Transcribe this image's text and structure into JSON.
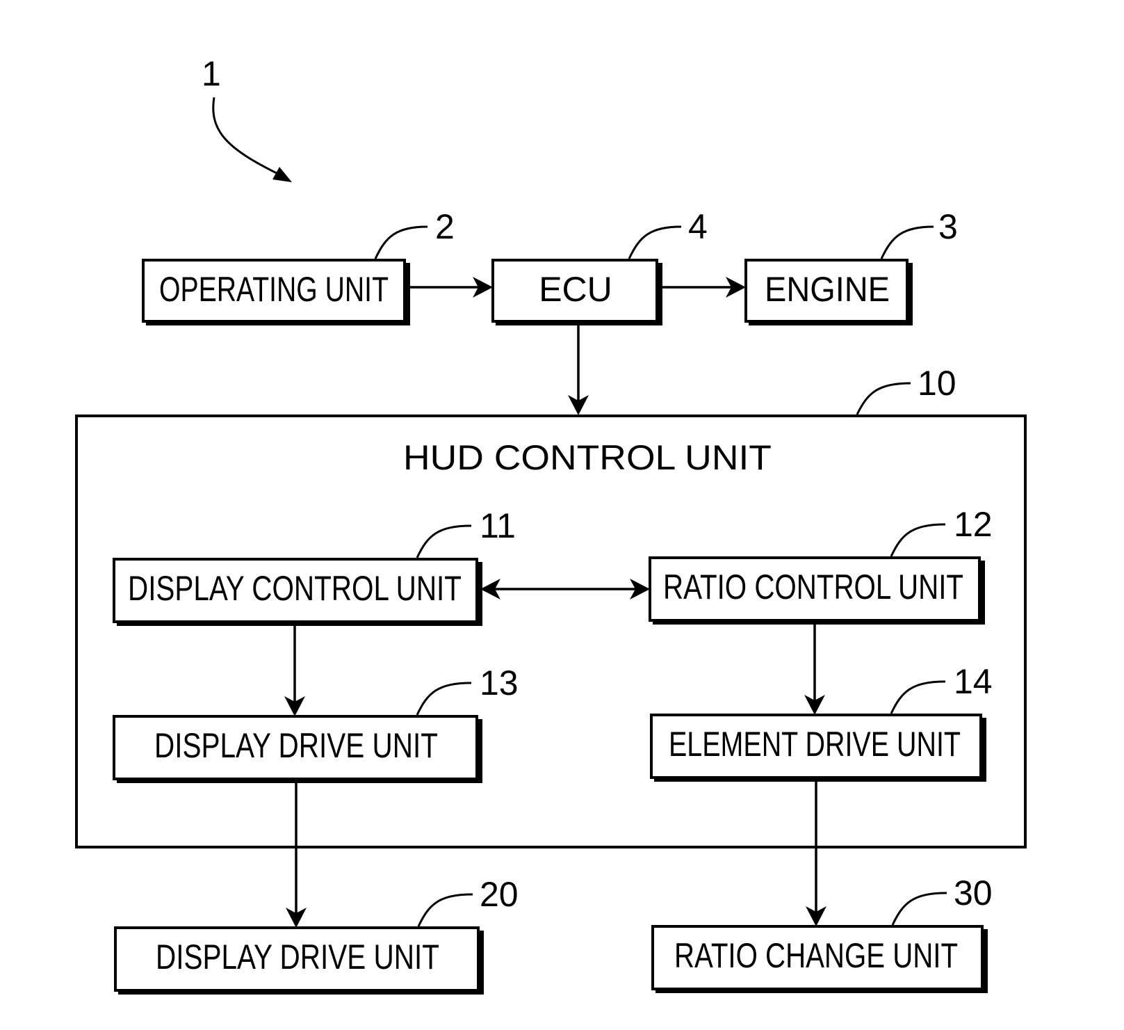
{
  "figure": {
    "reference": "1"
  },
  "blocks": {
    "operating_unit": {
      "label": "OPERATING UNIT",
      "ref": "2"
    },
    "ecu": {
      "label": "ECU",
      "ref": "4"
    },
    "engine": {
      "label": "ENGINE",
      "ref": "3"
    },
    "hud_control_unit": {
      "label": "HUD CONTROL UNIT",
      "ref": "10"
    },
    "display_control_unit": {
      "label": "DISPLAY CONTROL UNIT",
      "ref": "11"
    },
    "ratio_control_unit": {
      "label": "RATIO CONTROL UNIT",
      "ref": "12"
    },
    "display_drive_unit_inner": {
      "label": "DISPLAY DRIVE UNIT",
      "ref": "13"
    },
    "element_drive_unit": {
      "label": "ELEMENT DRIVE UNIT",
      "ref": "14"
    },
    "display_drive_unit_outer": {
      "label": "DISPLAY DRIVE UNIT",
      "ref": "20"
    },
    "ratio_change_unit": {
      "label": "RATIO CHANGE UNIT",
      "ref": "30"
    }
  },
  "connections": [
    {
      "from": "OPERATING UNIT",
      "to": "ECU",
      "direction": "one-way"
    },
    {
      "from": "ECU",
      "to": "ENGINE",
      "direction": "one-way"
    },
    {
      "from": "ECU",
      "to": "HUD CONTROL UNIT",
      "direction": "one-way"
    },
    {
      "from": "DISPLAY CONTROL UNIT",
      "to": "RATIO CONTROL UNIT",
      "direction": "two-way"
    },
    {
      "from": "DISPLAY CONTROL UNIT",
      "to": "DISPLAY DRIVE UNIT (13)",
      "direction": "one-way"
    },
    {
      "from": "RATIO CONTROL UNIT",
      "to": "ELEMENT DRIVE UNIT",
      "direction": "one-way"
    },
    {
      "from": "DISPLAY DRIVE UNIT (13)",
      "to": "DISPLAY DRIVE UNIT (20)",
      "direction": "one-way"
    },
    {
      "from": "ELEMENT DRIVE UNIT",
      "to": "RATIO CHANGE UNIT",
      "direction": "one-way"
    }
  ]
}
